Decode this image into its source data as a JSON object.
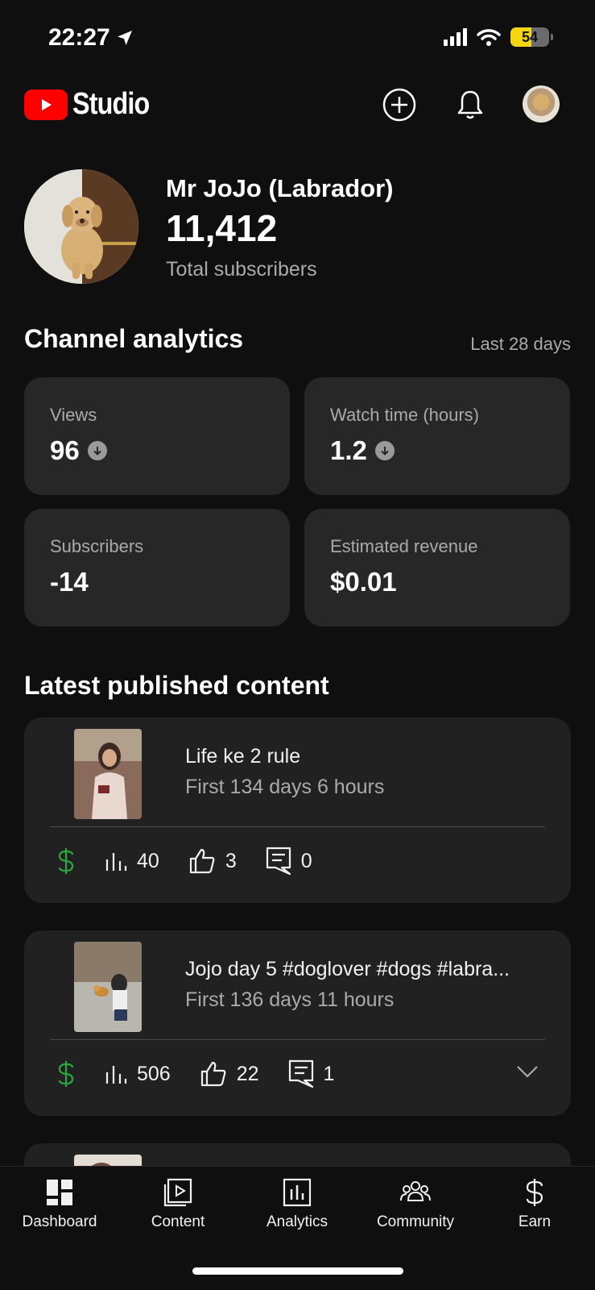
{
  "status_bar": {
    "time": "22:27",
    "battery": "54",
    "battery_level": 0.54
  },
  "header": {
    "logo_text": "Studio"
  },
  "channel": {
    "name": "Mr JoJo (Labrador)",
    "subscribers": "11,412",
    "subscribers_label": "Total subscribers"
  },
  "analytics": {
    "title": "Channel analytics",
    "range": "Last 28 days",
    "cards": [
      {
        "label": "Views",
        "value": "96",
        "trend": "down"
      },
      {
        "label": "Watch time (hours)",
        "value": "1.2",
        "trend": "down"
      },
      {
        "label": "Subscribers",
        "value": "-14"
      },
      {
        "label": "Estimated revenue",
        "value": "$0.01"
      }
    ]
  },
  "latest": {
    "title": "Latest published content",
    "videos": [
      {
        "title": "Life ke 2 rule",
        "age": "First 134 days 6 hours",
        "views": "40",
        "likes": "3",
        "comments": "0"
      },
      {
        "title": "Jojo day 5 #doglover #dogs #labra...",
        "age": "First 136 days 11 hours",
        "views": "506",
        "likes": "22",
        "comments": "1"
      }
    ]
  },
  "nav": [
    {
      "label": "Dashboard",
      "icon": "dashboard-icon"
    },
    {
      "label": "Content",
      "icon": "content-icon"
    },
    {
      "label": "Analytics",
      "icon": "analytics-icon"
    },
    {
      "label": "Community",
      "icon": "community-icon"
    },
    {
      "label": "Earn",
      "icon": "earn-icon"
    }
  ],
  "colors": {
    "accent_red": "#ff0000",
    "money_green": "#2ba640",
    "card_bg": "#272727",
    "battery_yellow": "#f6d511"
  }
}
